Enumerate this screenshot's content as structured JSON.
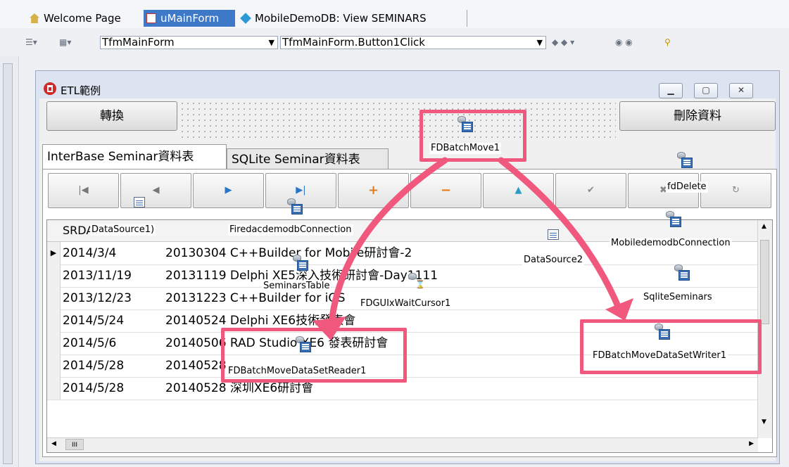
{
  "ide": {
    "tabs": [
      {
        "label": "Welcome Page",
        "icon": "home-icon"
      },
      {
        "label": "uMainForm",
        "icon": "form-icon",
        "active": true
      },
      {
        "label": "MobileDemoDB: View SEMINARS",
        "icon": "database-view-icon"
      }
    ],
    "class_combo": "TfmMainForm",
    "method_combo": "TfmMainForm.Button1Click"
  },
  "form": {
    "title": "ETL範例",
    "convert_button": "轉換",
    "delete_button": "刪除資料",
    "tabs": [
      "InterBase Seminar資料表",
      "SQLite Seminar資料表"
    ],
    "grid": {
      "header_col1": "SRDAT",
      "rows": [
        {
          "date": "2014/3/4",
          "text": "20130304 C++Builder for Mobile研討會-2",
          "current": true
        },
        {
          "date": "2013/11/19",
          "text": "20131119 Delphi XE5深入技術研討會-Day1111"
        },
        {
          "date": "2013/12/23",
          "text": "20131223 C++Builder for iOS"
        },
        {
          "date": "2014/5/24",
          "text": "20140524 Delphi XE6技術發表會"
        },
        {
          "date": "2014/5/6",
          "text": "20140506 RAD Studio XE6 發表研討會"
        },
        {
          "date": "2014/5/28",
          "text": "20140528"
        },
        {
          "date": "2014/5/28",
          "text": "20140528 深圳XE6研討會"
        }
      ],
      "scroll_thumb": "III"
    }
  },
  "components": {
    "batch_move": "FDBatchMove1",
    "datasource1": "DataSource1)",
    "connection": "FiredacdemodbConnection",
    "seminars_table": "SeminarsTable",
    "wait_cursor": "FDGUIxWaitCursor1",
    "reader": "FDBatchMoveDataSetReader1",
    "datasource2": "DataSource2",
    "fd_delete": "fdDelete",
    "mobile_connection": "MobiledemodbConnection",
    "sqlite_seminars": "SqliteSeminars",
    "writer": "FDBatchMoveDataSetWriter1"
  },
  "colors": {
    "highlight": "#f0587e",
    "ide_active_tab": "#3e78c8"
  }
}
